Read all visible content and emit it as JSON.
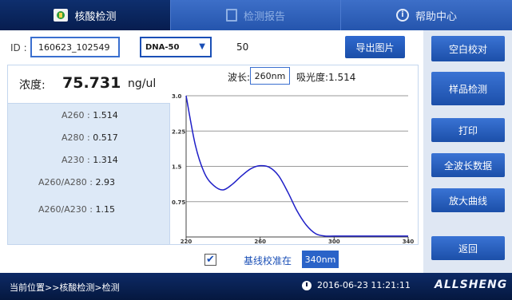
{
  "tabs": [
    {
      "label": "核酸检测",
      "icon": "dna-icon",
      "active": true
    },
    {
      "label": "检测报告",
      "icon": "report-icon",
      "active": false
    },
    {
      "label": "帮助中心",
      "icon": "info-icon",
      "active": false
    }
  ],
  "form": {
    "id_label": "ID :",
    "id_value": "160623_102549",
    "sample_type": "DNA-50",
    "factor": "50",
    "export_label": "导出图片"
  },
  "result": {
    "conc_label": "浓度:",
    "conc_value": "75.731",
    "conc_unit": "ng/ul",
    "a260_label": "A260 : ",
    "a260_value": "1.514",
    "a280_label": "A280 : ",
    "a280_value": "0.517",
    "a230_label": "A230 : ",
    "a230_value": "1.314",
    "r260_280_label": "A260/A280 : ",
    "r260_280_value": "2.93",
    "r260_230_label": "A260/A230 : ",
    "r260_230_value": "1.15"
  },
  "readout": {
    "wavelength_label": "波长:",
    "wavelength_value": "260nm",
    "absorbance_label": "吸光度:",
    "absorbance_value": "1.514"
  },
  "baseline": {
    "checked": true,
    "check_glyph": "✔",
    "label": "基线校准在",
    "value": "340nm"
  },
  "sidebar": {
    "buttons": [
      "空白校对",
      "样品检测",
      "打印",
      "全波长数据",
      "放大曲线",
      "返回"
    ]
  },
  "status": {
    "breadcrumb": "当前位置>>核酸检测>检测",
    "datetime": "2016-06-23 11:21:11",
    "brand": "ALLSHENG"
  },
  "colors": {
    "accent": "#2a63c8",
    "curve": "#1f1fc7"
  },
  "chart_data": {
    "type": "line",
    "x_ticks": [
      "220",
      "260",
      "300",
      "340"
    ],
    "y_ticks": [
      "3.0",
      "2.25",
      "1.5",
      "0.75"
    ],
    "xlim": [
      220,
      340
    ],
    "ylim": [
      0,
      3.0
    ],
    "grid": true,
    "series": [
      {
        "x": [
          220,
          225,
          230,
          235,
          240,
          245,
          250,
          255,
          260,
          265,
          270,
          275,
          280,
          285,
          290,
          295,
          300,
          310,
          320,
          330,
          340
        ],
        "y": [
          3.0,
          1.95,
          1.35,
          1.09,
          1.0,
          1.12,
          1.3,
          1.45,
          1.514,
          1.48,
          1.3,
          0.95,
          0.55,
          0.25,
          0.07,
          0.02,
          0.02,
          0.02,
          0.02,
          0.02,
          0.02
        ]
      }
    ]
  }
}
